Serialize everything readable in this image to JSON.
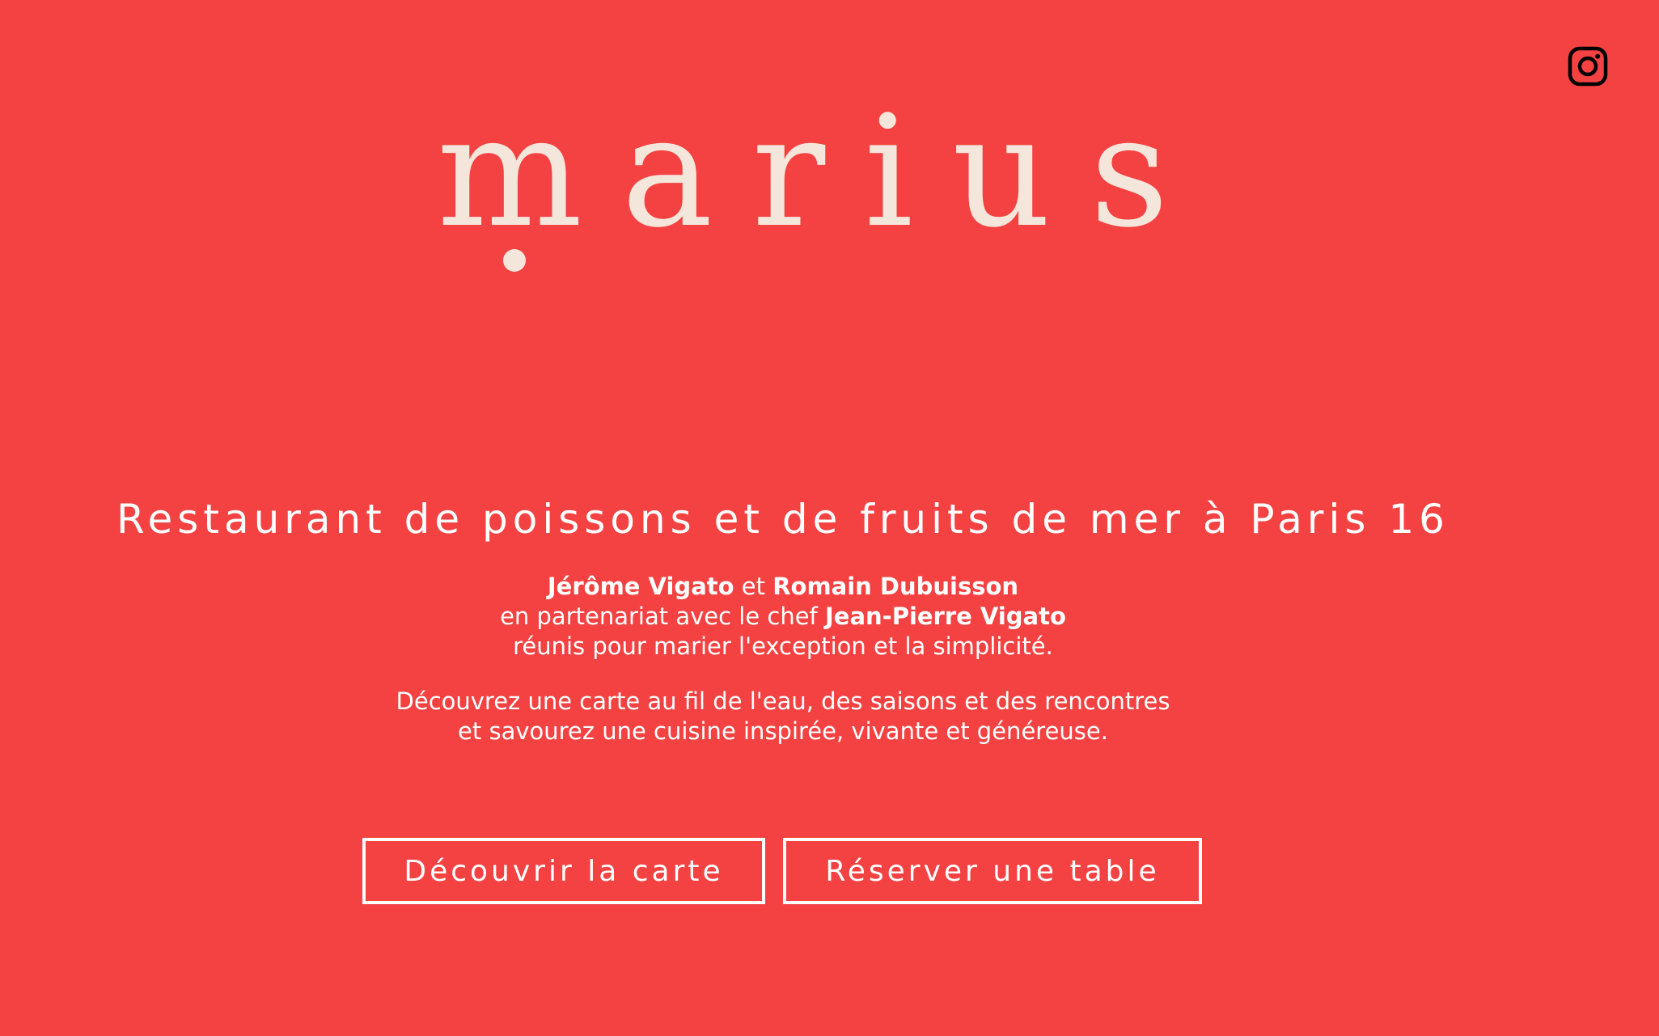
{
  "brand": {
    "logo_text": "marius",
    "logo_color": "#F4E6DB",
    "background_color": "#F44141"
  },
  "header": {
    "social_icon": "instagram-icon"
  },
  "hero": {
    "headline": "Restaurant de poissons et de fruits de mer à Paris 16",
    "intro": {
      "name_1": "Jérôme Vigato",
      "connector": "et",
      "name_2": "Romain Dubuisson",
      "line_2_prefix": "en partenariat avec le chef",
      "chef_name": "Jean-Pierre Vigato",
      "line_3": "réunis pour marier l'exception et la simplicité."
    },
    "discover": {
      "line_1": "Découvrez une carte au fil de l'eau, des saisons et des rencontres",
      "line_2": "et savourez une cuisine inspirée, vivante et généreuse."
    }
  },
  "actions": {
    "menu_label": "Découvrir la carte",
    "booking_label": "Réserver une table"
  }
}
